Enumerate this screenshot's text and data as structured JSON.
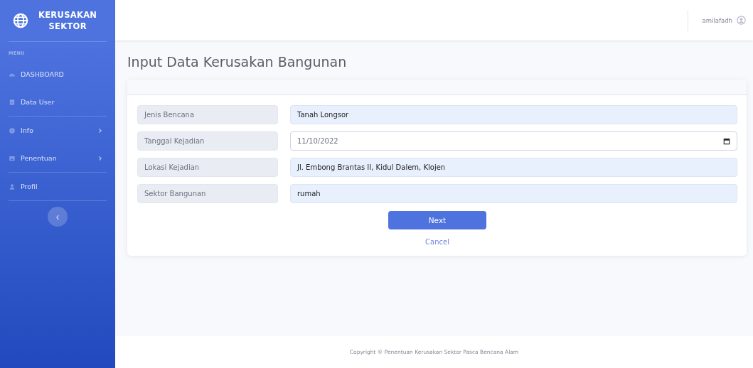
{
  "brand": {
    "line1": "KERUSAKAN",
    "line2": "SEKTOR"
  },
  "sidebar": {
    "heading": "MENU",
    "items": [
      {
        "label": "DASHBOARD",
        "has_submenu": false,
        "divider_after": false
      },
      {
        "label": "Data User",
        "has_submenu": false,
        "divider_after": true
      },
      {
        "label": "Info",
        "has_submenu": true,
        "divider_after": false
      },
      {
        "label": "Penentuan",
        "has_submenu": true,
        "divider_after": true
      },
      {
        "label": "Profil",
        "has_submenu": false,
        "divider_after": true
      }
    ],
    "toggle": "‹"
  },
  "topbar": {
    "user": "amilafadh"
  },
  "page_title": "Input Data Kerusakan Bangunan",
  "form": {
    "fields": [
      {
        "label": "Jenis Bencana",
        "value": "Tanah Longsor",
        "kind": "text"
      },
      {
        "label": "Tanggal Kejadian",
        "value": "11/10/2022",
        "kind": "date"
      },
      {
        "label": "Lokasi Kejadian",
        "value": "Jl. Embong Brantas II, Kidul Dalem, Klojen",
        "kind": "text"
      },
      {
        "label": "Sektor Bangunan",
        "value": "rumah",
        "kind": "text"
      }
    ],
    "submit": "Next",
    "cancel": "Cancel"
  },
  "footer": "Copyright © Penentuan Kerusakan Sektor Pasca Bencana Alam"
}
